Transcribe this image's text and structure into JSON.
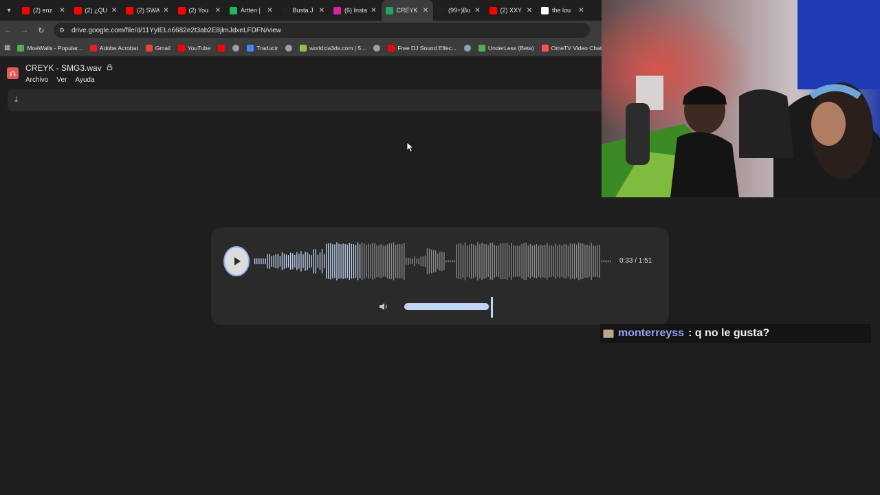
{
  "browser": {
    "tabs": [
      {
        "title": "(2) enz",
        "icon": "youtube-icon",
        "color": "#ff0000"
      },
      {
        "title": "(2) ¿QU",
        "icon": "youtube-icon",
        "color": "#ff0000"
      },
      {
        "title": "(2) SWA",
        "icon": "youtube-icon",
        "color": "#ff0000"
      },
      {
        "title": "(2) You",
        "icon": "youtube-icon",
        "color": "#ff0000"
      },
      {
        "title": "Artten |",
        "icon": "spotify-icon",
        "color": "#1db954"
      },
      {
        "title": "Busta J",
        "icon": "tiktok-icon",
        "color": "#222222"
      },
      {
        "title": "(6) Insta",
        "icon": "instagram-icon",
        "color": "#d6249f"
      },
      {
        "title": "CREYK",
        "icon": "google-drive-icon",
        "color": "#1fa463"
      },
      {
        "title": "(99+)Bu",
        "icon": "tiktok-icon",
        "color": "#222222"
      },
      {
        "title": "(2) XXY",
        "icon": "youtube-icon",
        "color": "#ff0000"
      },
      {
        "title": "the lou",
        "icon": "google-icon",
        "color": "#ffffff"
      }
    ],
    "active_tab_index": 7,
    "url": "drive.google.com/file/d/11YyIELo6682e2t3ab2E8jlmJdxeLFDFN/view",
    "bookmarks": [
      {
        "label": "MoeWalls - Popular...",
        "icon": "moewalls-icon",
        "color": "#4caf50"
      },
      {
        "label": "Adobe Acrobat",
        "icon": "acrobat-icon",
        "color": "#e2231a"
      },
      {
        "label": "Gmail",
        "icon": "gmail-icon",
        "color": "#ea4335"
      },
      {
        "label": "YouTube",
        "icon": "youtube-icon",
        "color": "#ff0000"
      },
      {
        "label": "",
        "icon": "youtube-icon",
        "color": "#ff0000"
      },
      {
        "label": "",
        "icon": "globe-icon",
        "color": "#9aa0a6"
      },
      {
        "label": "Traducir",
        "icon": "translate-icon",
        "color": "#4285f4"
      },
      {
        "label": "",
        "icon": "globe-icon",
        "color": "#9aa0a6"
      },
      {
        "label": "worldcia3ds.com | 5...",
        "icon": "worldcia-icon",
        "color": "#8bc34a"
      },
      {
        "label": "",
        "icon": "globe-icon",
        "color": "#9aa0a6"
      },
      {
        "label": "Free DJ Sound Effec...",
        "icon": "youtube-icon",
        "color": "#ff0000"
      },
      {
        "label": "",
        "icon": "globe-icon",
        "color": "#9aa0a6"
      },
      {
        "label": "UnderLess (Beta)",
        "icon": "underless-icon",
        "color": "#4caf50"
      },
      {
        "label": "OmeTV Video Chat...",
        "icon": "ometv-icon",
        "color": "#ff5252"
      }
    ]
  },
  "drive": {
    "file_title": "CREYK - SMG3.wav",
    "menus": [
      "Archivo",
      "Ver",
      "Ayuda"
    ]
  },
  "player": {
    "time": "0:33 / 1:51",
    "progress": 0.3,
    "volume": 0.99,
    "accent": "#8ab4f8"
  },
  "chat": {
    "username": "monterreyss",
    "message": ": q no le gusta?"
  }
}
